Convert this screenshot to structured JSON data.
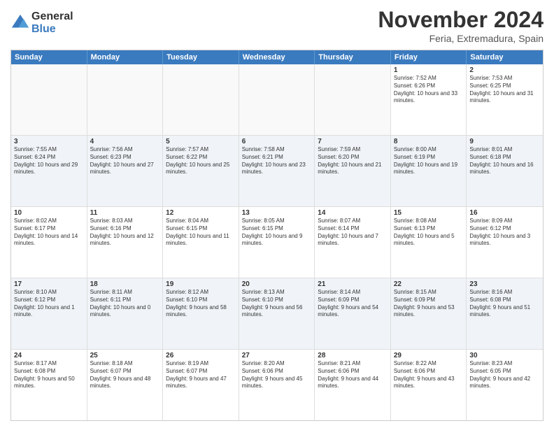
{
  "logo": {
    "general": "General",
    "blue": "Blue"
  },
  "title": "November 2024",
  "location": "Feria, Extremadura, Spain",
  "days": [
    "Sunday",
    "Monday",
    "Tuesday",
    "Wednesday",
    "Thursday",
    "Friday",
    "Saturday"
  ],
  "rows": [
    [
      {
        "day": "",
        "info": ""
      },
      {
        "day": "",
        "info": ""
      },
      {
        "day": "",
        "info": ""
      },
      {
        "day": "",
        "info": ""
      },
      {
        "day": "",
        "info": ""
      },
      {
        "day": "1",
        "info": "Sunrise: 7:52 AM\nSunset: 6:26 PM\nDaylight: 10 hours and 33 minutes."
      },
      {
        "day": "2",
        "info": "Sunrise: 7:53 AM\nSunset: 6:25 PM\nDaylight: 10 hours and 31 minutes."
      }
    ],
    [
      {
        "day": "3",
        "info": "Sunrise: 7:55 AM\nSunset: 6:24 PM\nDaylight: 10 hours and 29 minutes."
      },
      {
        "day": "4",
        "info": "Sunrise: 7:56 AM\nSunset: 6:23 PM\nDaylight: 10 hours and 27 minutes."
      },
      {
        "day": "5",
        "info": "Sunrise: 7:57 AM\nSunset: 6:22 PM\nDaylight: 10 hours and 25 minutes."
      },
      {
        "day": "6",
        "info": "Sunrise: 7:58 AM\nSunset: 6:21 PM\nDaylight: 10 hours and 23 minutes."
      },
      {
        "day": "7",
        "info": "Sunrise: 7:59 AM\nSunset: 6:20 PM\nDaylight: 10 hours and 21 minutes."
      },
      {
        "day": "8",
        "info": "Sunrise: 8:00 AM\nSunset: 6:19 PM\nDaylight: 10 hours and 19 minutes."
      },
      {
        "day": "9",
        "info": "Sunrise: 8:01 AM\nSunset: 6:18 PM\nDaylight: 10 hours and 16 minutes."
      }
    ],
    [
      {
        "day": "10",
        "info": "Sunrise: 8:02 AM\nSunset: 6:17 PM\nDaylight: 10 hours and 14 minutes."
      },
      {
        "day": "11",
        "info": "Sunrise: 8:03 AM\nSunset: 6:16 PM\nDaylight: 10 hours and 12 minutes."
      },
      {
        "day": "12",
        "info": "Sunrise: 8:04 AM\nSunset: 6:15 PM\nDaylight: 10 hours and 11 minutes."
      },
      {
        "day": "13",
        "info": "Sunrise: 8:05 AM\nSunset: 6:15 PM\nDaylight: 10 hours and 9 minutes."
      },
      {
        "day": "14",
        "info": "Sunrise: 8:07 AM\nSunset: 6:14 PM\nDaylight: 10 hours and 7 minutes."
      },
      {
        "day": "15",
        "info": "Sunrise: 8:08 AM\nSunset: 6:13 PM\nDaylight: 10 hours and 5 minutes."
      },
      {
        "day": "16",
        "info": "Sunrise: 8:09 AM\nSunset: 6:12 PM\nDaylight: 10 hours and 3 minutes."
      }
    ],
    [
      {
        "day": "17",
        "info": "Sunrise: 8:10 AM\nSunset: 6:12 PM\nDaylight: 10 hours and 1 minute."
      },
      {
        "day": "18",
        "info": "Sunrise: 8:11 AM\nSunset: 6:11 PM\nDaylight: 10 hours and 0 minutes."
      },
      {
        "day": "19",
        "info": "Sunrise: 8:12 AM\nSunset: 6:10 PM\nDaylight: 9 hours and 58 minutes."
      },
      {
        "day": "20",
        "info": "Sunrise: 8:13 AM\nSunset: 6:10 PM\nDaylight: 9 hours and 56 minutes."
      },
      {
        "day": "21",
        "info": "Sunrise: 8:14 AM\nSunset: 6:09 PM\nDaylight: 9 hours and 54 minutes."
      },
      {
        "day": "22",
        "info": "Sunrise: 8:15 AM\nSunset: 6:09 PM\nDaylight: 9 hours and 53 minutes."
      },
      {
        "day": "23",
        "info": "Sunrise: 8:16 AM\nSunset: 6:08 PM\nDaylight: 9 hours and 51 minutes."
      }
    ],
    [
      {
        "day": "24",
        "info": "Sunrise: 8:17 AM\nSunset: 6:08 PM\nDaylight: 9 hours and 50 minutes."
      },
      {
        "day": "25",
        "info": "Sunrise: 8:18 AM\nSunset: 6:07 PM\nDaylight: 9 hours and 48 minutes."
      },
      {
        "day": "26",
        "info": "Sunrise: 8:19 AM\nSunset: 6:07 PM\nDaylight: 9 hours and 47 minutes."
      },
      {
        "day": "27",
        "info": "Sunrise: 8:20 AM\nSunset: 6:06 PM\nDaylight: 9 hours and 45 minutes."
      },
      {
        "day": "28",
        "info": "Sunrise: 8:21 AM\nSunset: 6:06 PM\nDaylight: 9 hours and 44 minutes."
      },
      {
        "day": "29",
        "info": "Sunrise: 8:22 AM\nSunset: 6:06 PM\nDaylight: 9 hours and 43 minutes."
      },
      {
        "day": "30",
        "info": "Sunrise: 8:23 AM\nSunset: 6:05 PM\nDaylight: 9 hours and 42 minutes."
      }
    ]
  ]
}
